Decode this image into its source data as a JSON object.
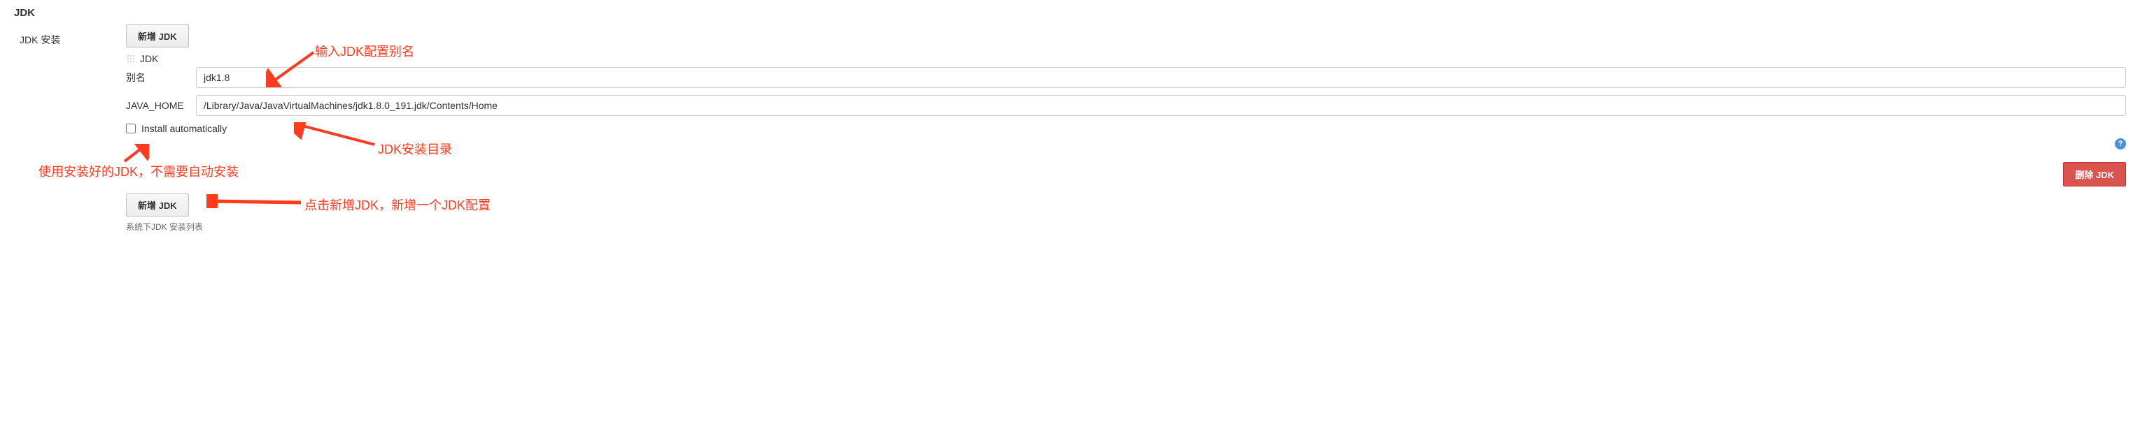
{
  "section": {
    "title": "JDK",
    "sidebar_label": "JDK 安装"
  },
  "buttons": {
    "add_jdk_top": "新增 JDK",
    "add_jdk_bottom": "新增 JDK",
    "delete_jdk": "删除 JDK"
  },
  "instance": {
    "header_label": "JDK",
    "fields": {
      "alias_label": "别名",
      "alias_value": "jdk1.8",
      "java_home_label": "JAVA_HOME",
      "java_home_value": "/Library/Java/JavaVirtualMachines/jdk1.8.0_191.jdk/Contents/Home"
    },
    "install_auto_label": "Install automatically",
    "install_auto_checked": false
  },
  "footer_note": "系统下JDK 安装列表",
  "annotations": {
    "a1": "输入JDK配置别名",
    "a2": "JDK安装目录",
    "a3": "使用安装好的JDK，不需要自动安装",
    "a4": "点击新增JDK，新增一个JDK配置"
  },
  "colors": {
    "annotation": "#ff3b1f",
    "danger_btn": "#d9534f"
  },
  "help_glyph": "?"
}
